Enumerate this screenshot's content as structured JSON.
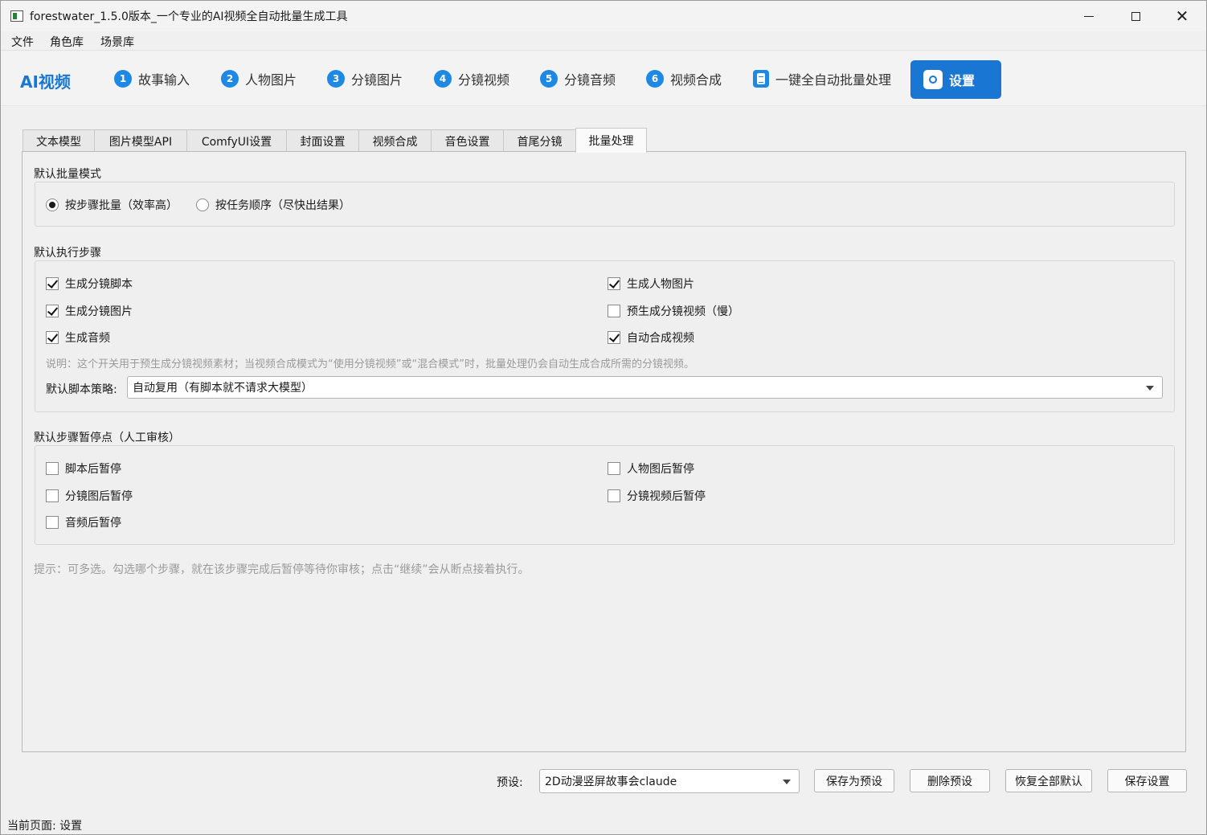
{
  "window": {
    "title": "forestwater_1.5.0版本_一个专业的AI视频全自动批量生成工具",
    "controls": {
      "minimize": "minimize",
      "maximize": "maximize",
      "close": "✕"
    }
  },
  "menu": [
    "文件",
    "角色库",
    "场景库"
  ],
  "nav": {
    "brand": "AI视频",
    "steps": [
      {
        "num": "1",
        "label": "故事输入"
      },
      {
        "num": "2",
        "label": "人物图片"
      },
      {
        "num": "3",
        "label": "分镜图片"
      },
      {
        "num": "4",
        "label": "分镜视频"
      },
      {
        "num": "5",
        "label": "分镜音频"
      },
      {
        "num": "6",
        "label": "视频合成"
      }
    ],
    "batch_label": "一键全自动批量处理",
    "settings_label": "设置",
    "accent_color": "#1976d2"
  },
  "tabs": [
    "文本模型",
    "图片模型API",
    "ComfyUI设置",
    "封面设置",
    "视频合成",
    "音色设置",
    "首尾分镜",
    "批量处理"
  ],
  "active_tab": "批量处理",
  "batch_mode": {
    "title": "默认批量模式",
    "options": [
      {
        "label": "按步骤批量（效率高）",
        "checked": true
      },
      {
        "label": "按任务顺序（尽快出结果）",
        "checked": false
      }
    ]
  },
  "steps": {
    "title": "默认执行步骤",
    "items": [
      {
        "label": "生成分镜脚本",
        "checked": true
      },
      {
        "label": "生成人物图片",
        "checked": true
      },
      {
        "label": "生成分镜图片",
        "checked": true
      },
      {
        "label": "预生成分镜视频（慢）",
        "checked": false
      },
      {
        "label": "生成音频",
        "checked": true
      },
      {
        "label": "自动合成视频",
        "checked": true
      }
    ],
    "note": "说明：这个开关用于预生成分镜视频素材；当视频合成模式为“使用分镜视频”或“混合模式”时，批量处理仍会自动生成合成所需的分镜视频。",
    "script_strategy_label": "默认脚本策略:",
    "script_strategy_value": "自动复用（有脚本就不请求大模型）"
  },
  "pauses": {
    "title": "默认步骤暂停点（人工审核）",
    "items": [
      {
        "label": "脚本后暂停",
        "checked": false
      },
      {
        "label": "人物图后暂停",
        "checked": false
      },
      {
        "label": "分镜图后暂停",
        "checked": false
      },
      {
        "label": "分镜视频后暂停",
        "checked": false
      },
      {
        "label": "音频后暂停",
        "checked": false
      }
    ]
  },
  "hint": "提示：可多选。勾选哪个步骤，就在该步骤完成后暂停等待你审核；点击“继续”会从断点接着执行。",
  "footer": {
    "preset_label": "预设:",
    "preset_value": "2D动漫竖屏故事会claude",
    "buttons": [
      "保存为预设",
      "删除预设",
      "恢复全部默认",
      "保存设置"
    ]
  },
  "status": "当前页面: 设置"
}
